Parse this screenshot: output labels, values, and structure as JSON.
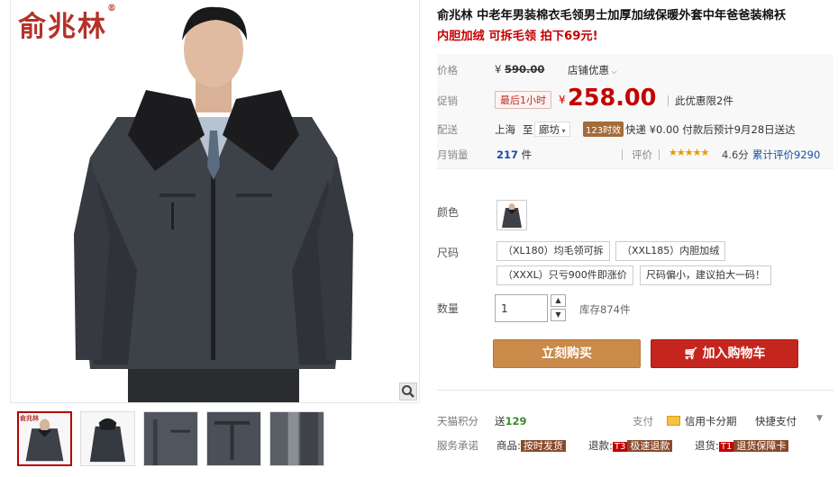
{
  "gallery": {
    "brand": "俞兆林",
    "brand_mark": "®",
    "thumb_brand": "俞兆林"
  },
  "product": {
    "title": "俞兆林 中老年男装棉衣毛领男士加厚加绒保暖外套中年爸爸装棉袄",
    "subtitle": "内胆加绒 可拆毛领 拍下69元!"
  },
  "price": {
    "label": "价格",
    "original_symbol": "¥",
    "original": "590.00",
    "shop_promo": "店铺优惠",
    "promo_label": "促销",
    "badge": "最后1小时",
    "yen": "¥",
    "current": "258.00",
    "limit": "此优惠限2件"
  },
  "shipping": {
    "label": "配送",
    "from": "上海",
    "to_word": "至",
    "dest": "廊坊",
    "time_badge": "123时效",
    "express": "快递 ¥0.00 付款后预计9月28日送达"
  },
  "sales": {
    "label": "月销量",
    "count": "217",
    "unit": "件",
    "review_label": "评价",
    "stars": "★★★★★",
    "score": "4.6分",
    "review_total": "累计评价9290"
  },
  "options": {
    "color_label": "颜色",
    "size_label": "尺码",
    "sizes": [
      "（XL180）均毛领可拆",
      "（XXL185）内胆加绒",
      "（XXXL）只亏900件即涨价",
      "尺码偏小，建议拍大一码！"
    ],
    "qty_label": "数量",
    "qty_value": "1",
    "qty_up": "▲",
    "qty_down": "▼",
    "stock": "库存874件"
  },
  "actions": {
    "buy": "立刻购买",
    "cart": "加入购物车"
  },
  "footer": {
    "points_label": "天猫积分",
    "points_prefix": "送",
    "points": "129",
    "pay_label": "支付",
    "pay_card": "信用卡分期",
    "pay_quick": "快捷支付",
    "service_label": "服务承诺",
    "item_prefix": "商品:",
    "item_tag": "按时发货",
    "return_prefix": "退款:",
    "return_code": "T3",
    "return_tag": "极速退款",
    "goods_prefix": "退货:",
    "goods_code": "T1",
    "goods_tag": "退货保障卡"
  },
  "colors": {
    "accent_red": "#c40000",
    "buy_orange": "#c98a4a",
    "cart_red": "#c4261d"
  }
}
